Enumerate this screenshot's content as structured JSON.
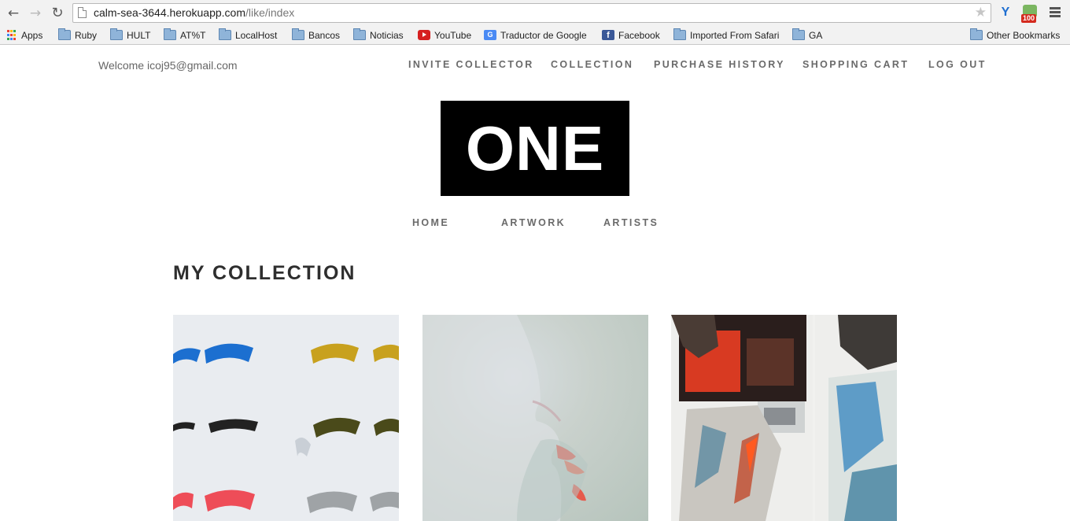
{
  "browser": {
    "url_host": "calm-sea-3644.herokuapp.com",
    "url_path": "/like/index",
    "extension_badge": "100",
    "bookmarks": [
      {
        "label": "Apps",
        "icon": "apps-icon"
      },
      {
        "label": "Ruby",
        "icon": "folder-icon"
      },
      {
        "label": "HULT",
        "icon": "folder-icon"
      },
      {
        "label": "AT%T",
        "icon": "folder-icon"
      },
      {
        "label": "LocalHost",
        "icon": "folder-icon"
      },
      {
        "label": "Bancos",
        "icon": "folder-icon"
      },
      {
        "label": "Noticias",
        "icon": "folder-icon"
      },
      {
        "label": "YouTube",
        "icon": "youtube-icon"
      },
      {
        "label": "Traductor de Google",
        "icon": "google-translate-icon"
      },
      {
        "label": "Facebook",
        "icon": "facebook-icon"
      },
      {
        "label": "Imported From Safari",
        "icon": "folder-icon"
      },
      {
        "label": "GA",
        "icon": "folder-icon"
      }
    ],
    "other_bookmarks": "Other Bookmarks"
  },
  "header": {
    "welcome": "Welcome icoj95@gmail.com",
    "nav": [
      "INVITE COLLECTOR",
      "COLLECTION",
      "PURCHASE HISTORY",
      "SHOPPING CART",
      "LOG OUT"
    ]
  },
  "logo": {
    "text": "ONE"
  },
  "main_nav": [
    "HOME",
    "ARTWORK",
    "ARTISTS"
  ],
  "page_title": "MY COLLECTION",
  "colors": {
    "logo_bg": "#000000",
    "nav_text": "#6a6a6a",
    "title_text": "#2e2e2e"
  }
}
